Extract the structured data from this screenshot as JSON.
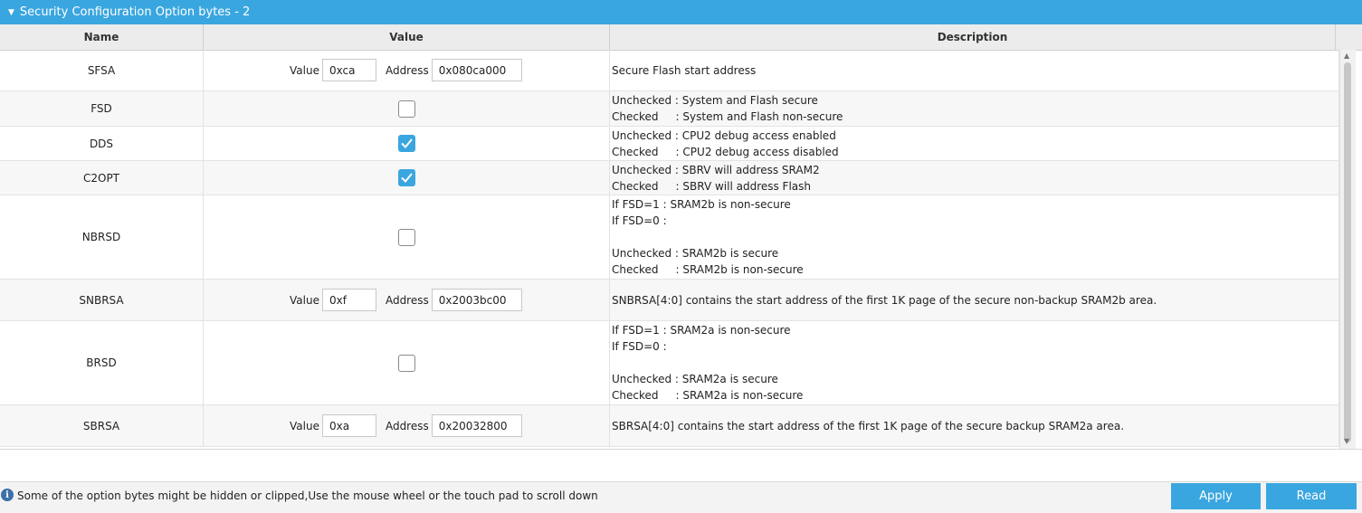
{
  "panel": {
    "title": "Security Configuration Option bytes - 2"
  },
  "header": {
    "name": "Name",
    "value": "Value",
    "description": "Description"
  },
  "labels": {
    "value": "Value",
    "address": "Address"
  },
  "rows": [
    {
      "name": "SFSA",
      "type": "addr",
      "value": "0xca",
      "address": "0x080ca000",
      "description": [
        "Secure Flash start address"
      ]
    },
    {
      "name": "FSD",
      "type": "check",
      "checked": false,
      "description": [
        "Unchecked : System and Flash secure",
        "Checked     : System and Flash non-secure"
      ]
    },
    {
      "name": "DDS",
      "type": "check",
      "checked": true,
      "description": [
        "Unchecked : CPU2 debug access enabled",
        "Checked     : CPU2 debug access disabled"
      ]
    },
    {
      "name": "C2OPT",
      "type": "check",
      "checked": true,
      "description": [
        "Unchecked : SBRV will address SRAM2",
        "Checked     : SBRV will address Flash"
      ]
    },
    {
      "name": "NBRSD",
      "type": "check",
      "checked": false,
      "description": [
        "If FSD=1 : SRAM2b is non-secure",
        "If FSD=0 :",
        "",
        "Unchecked : SRAM2b is secure",
        "Checked     : SRAM2b is non-secure"
      ]
    },
    {
      "name": "SNBRSA",
      "type": "addr",
      "value": "0xf",
      "address": "0x2003bc00",
      "description": [
        "SNBRSA[4:0] contains the start address of the first 1K page of the secure non-backup SRAM2b area."
      ]
    },
    {
      "name": "BRSD",
      "type": "check",
      "checked": false,
      "description": [
        "If FSD=1 : SRAM2a is non-secure",
        "If FSD=0 :",
        "",
        "Unchecked : SRAM2a is secure",
        "Checked     : SRAM2a is non-secure"
      ]
    },
    {
      "name": "SBRSA",
      "type": "addr",
      "value": "0xa",
      "address": "0x20032800",
      "description": [
        "SBRSA[4:0] contains the start address of the first 1K page of the secure backup SRAM2a area."
      ]
    }
  ],
  "status": {
    "message": "Some of the option bytes might be hidden or clipped,Use the mouse wheel or the touch pad to scroll down"
  },
  "buttons": {
    "apply": "Apply",
    "read": "Read"
  },
  "colors": {
    "accent": "#3aa6df"
  }
}
